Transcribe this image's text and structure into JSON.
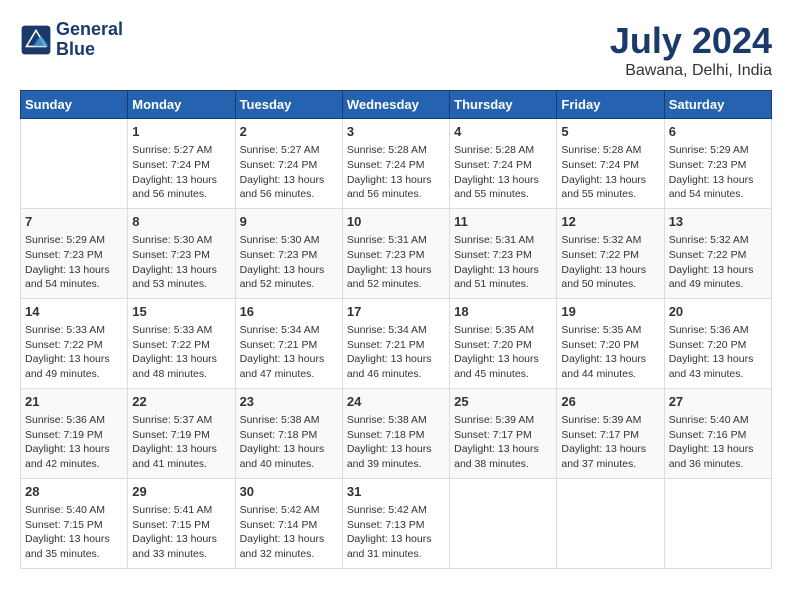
{
  "header": {
    "logo_line1": "General",
    "logo_line2": "Blue",
    "month": "July 2024",
    "location": "Bawana, Delhi, India"
  },
  "days_of_week": [
    "Sunday",
    "Monday",
    "Tuesday",
    "Wednesday",
    "Thursday",
    "Friday",
    "Saturday"
  ],
  "weeks": [
    [
      {
        "day": "",
        "info": ""
      },
      {
        "day": "1",
        "info": "Sunrise: 5:27 AM\nSunset: 7:24 PM\nDaylight: 13 hours\nand 56 minutes."
      },
      {
        "day": "2",
        "info": "Sunrise: 5:27 AM\nSunset: 7:24 PM\nDaylight: 13 hours\nand 56 minutes."
      },
      {
        "day": "3",
        "info": "Sunrise: 5:28 AM\nSunset: 7:24 PM\nDaylight: 13 hours\nand 56 minutes."
      },
      {
        "day": "4",
        "info": "Sunrise: 5:28 AM\nSunset: 7:24 PM\nDaylight: 13 hours\nand 55 minutes."
      },
      {
        "day": "5",
        "info": "Sunrise: 5:28 AM\nSunset: 7:24 PM\nDaylight: 13 hours\nand 55 minutes."
      },
      {
        "day": "6",
        "info": "Sunrise: 5:29 AM\nSunset: 7:23 PM\nDaylight: 13 hours\nand 54 minutes."
      }
    ],
    [
      {
        "day": "7",
        "info": "Sunrise: 5:29 AM\nSunset: 7:23 PM\nDaylight: 13 hours\nand 54 minutes."
      },
      {
        "day": "8",
        "info": "Sunrise: 5:30 AM\nSunset: 7:23 PM\nDaylight: 13 hours\nand 53 minutes."
      },
      {
        "day": "9",
        "info": "Sunrise: 5:30 AM\nSunset: 7:23 PM\nDaylight: 13 hours\nand 52 minutes."
      },
      {
        "day": "10",
        "info": "Sunrise: 5:31 AM\nSunset: 7:23 PM\nDaylight: 13 hours\nand 52 minutes."
      },
      {
        "day": "11",
        "info": "Sunrise: 5:31 AM\nSunset: 7:23 PM\nDaylight: 13 hours\nand 51 minutes."
      },
      {
        "day": "12",
        "info": "Sunrise: 5:32 AM\nSunset: 7:22 PM\nDaylight: 13 hours\nand 50 minutes."
      },
      {
        "day": "13",
        "info": "Sunrise: 5:32 AM\nSunset: 7:22 PM\nDaylight: 13 hours\nand 49 minutes."
      }
    ],
    [
      {
        "day": "14",
        "info": "Sunrise: 5:33 AM\nSunset: 7:22 PM\nDaylight: 13 hours\nand 49 minutes."
      },
      {
        "day": "15",
        "info": "Sunrise: 5:33 AM\nSunset: 7:22 PM\nDaylight: 13 hours\nand 48 minutes."
      },
      {
        "day": "16",
        "info": "Sunrise: 5:34 AM\nSunset: 7:21 PM\nDaylight: 13 hours\nand 47 minutes."
      },
      {
        "day": "17",
        "info": "Sunrise: 5:34 AM\nSunset: 7:21 PM\nDaylight: 13 hours\nand 46 minutes."
      },
      {
        "day": "18",
        "info": "Sunrise: 5:35 AM\nSunset: 7:20 PM\nDaylight: 13 hours\nand 45 minutes."
      },
      {
        "day": "19",
        "info": "Sunrise: 5:35 AM\nSunset: 7:20 PM\nDaylight: 13 hours\nand 44 minutes."
      },
      {
        "day": "20",
        "info": "Sunrise: 5:36 AM\nSunset: 7:20 PM\nDaylight: 13 hours\nand 43 minutes."
      }
    ],
    [
      {
        "day": "21",
        "info": "Sunrise: 5:36 AM\nSunset: 7:19 PM\nDaylight: 13 hours\nand 42 minutes."
      },
      {
        "day": "22",
        "info": "Sunrise: 5:37 AM\nSunset: 7:19 PM\nDaylight: 13 hours\nand 41 minutes."
      },
      {
        "day": "23",
        "info": "Sunrise: 5:38 AM\nSunset: 7:18 PM\nDaylight: 13 hours\nand 40 minutes."
      },
      {
        "day": "24",
        "info": "Sunrise: 5:38 AM\nSunset: 7:18 PM\nDaylight: 13 hours\nand 39 minutes."
      },
      {
        "day": "25",
        "info": "Sunrise: 5:39 AM\nSunset: 7:17 PM\nDaylight: 13 hours\nand 38 minutes."
      },
      {
        "day": "26",
        "info": "Sunrise: 5:39 AM\nSunset: 7:17 PM\nDaylight: 13 hours\nand 37 minutes."
      },
      {
        "day": "27",
        "info": "Sunrise: 5:40 AM\nSunset: 7:16 PM\nDaylight: 13 hours\nand 36 minutes."
      }
    ],
    [
      {
        "day": "28",
        "info": "Sunrise: 5:40 AM\nSunset: 7:15 PM\nDaylight: 13 hours\nand 35 minutes."
      },
      {
        "day": "29",
        "info": "Sunrise: 5:41 AM\nSunset: 7:15 PM\nDaylight: 13 hours\nand 33 minutes."
      },
      {
        "day": "30",
        "info": "Sunrise: 5:42 AM\nSunset: 7:14 PM\nDaylight: 13 hours\nand 32 minutes."
      },
      {
        "day": "31",
        "info": "Sunrise: 5:42 AM\nSunset: 7:13 PM\nDaylight: 13 hours\nand 31 minutes."
      },
      {
        "day": "",
        "info": ""
      },
      {
        "day": "",
        "info": ""
      },
      {
        "day": "",
        "info": ""
      }
    ]
  ]
}
